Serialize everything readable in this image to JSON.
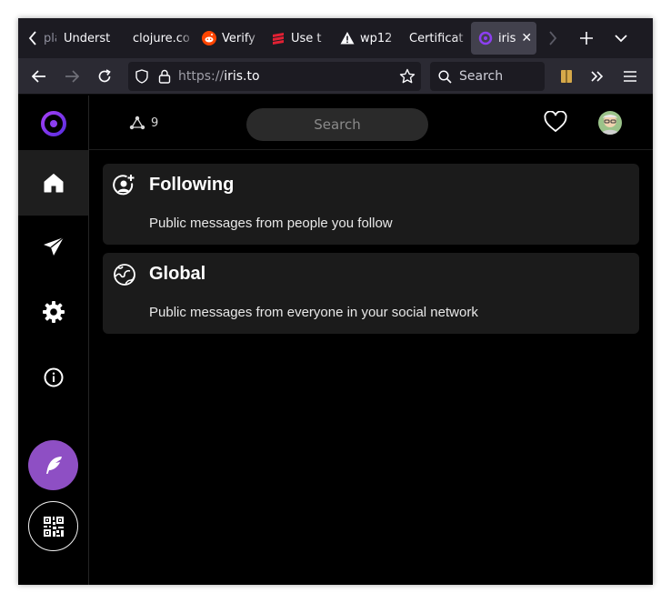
{
  "browser": {
    "tabs": [
      {
        "label": "pla",
        "icon": "none"
      },
      {
        "label": "Underst",
        "icon": "none"
      },
      {
        "label": "clojure.co",
        "icon": "none"
      },
      {
        "label": "Verify",
        "icon": "reddit-icon"
      },
      {
        "label": "Use t",
        "icon": "layers-icon"
      },
      {
        "label": "wp12",
        "icon": "warning-icon"
      },
      {
        "label": "Certificat",
        "icon": "none"
      },
      {
        "label": "iris",
        "icon": "iris-logo-icon",
        "active": true
      }
    ],
    "url_prefix": "https://",
    "url_host": "iris.to",
    "search_placeholder": "Search",
    "colors": {
      "tabbar": "#1c1b22",
      "navbar": "#2b2a33",
      "active_tab": "#42414d"
    }
  },
  "app": {
    "peer_count": "9",
    "search_placeholder": "Search",
    "accent": "#8e4fc4",
    "feeds": [
      {
        "title": "Following",
        "description": "Public messages from people you follow",
        "icon": "user-plus-circle-icon"
      },
      {
        "title": "Global",
        "description": "Public messages from everyone in your social network",
        "icon": "globe-icon"
      }
    ],
    "sidebar": [
      "home-icon",
      "send-icon",
      "settings-icon",
      "info-icon"
    ]
  }
}
